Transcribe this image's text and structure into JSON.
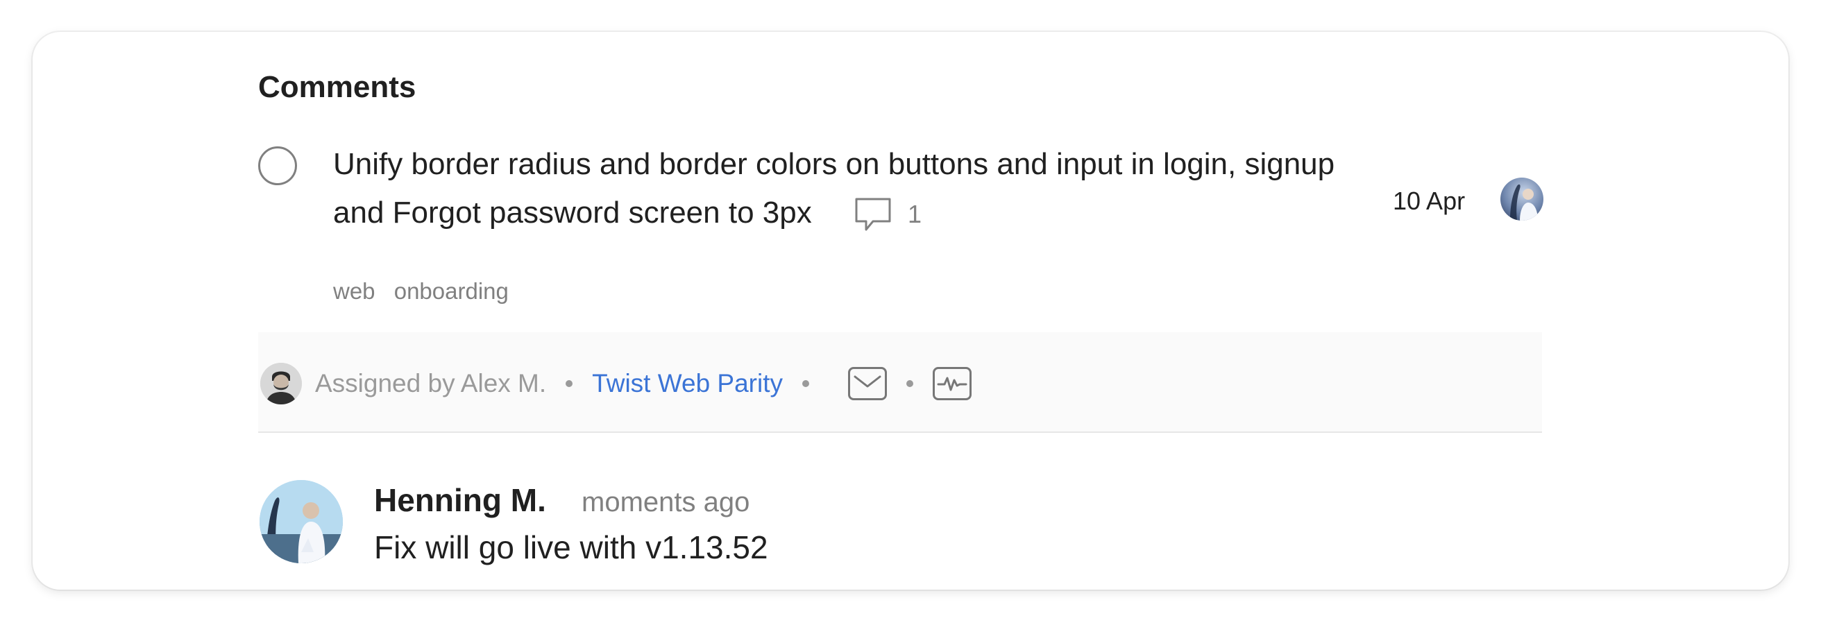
{
  "comments_panel": {
    "title": "Comments"
  },
  "task": {
    "content": "Unify border radius and border colors on buttons and input in login, signup and Forgot password screen to 3px",
    "comment_count": "1",
    "labels": [
      "web",
      "onboarding"
    ],
    "due_date": "10 Apr",
    "assignee_avatar_icon": "user-avatar"
  },
  "meta": {
    "assigned_by": "Assigned by Alex M.",
    "project": "Twist Web Parity",
    "mail_icon": "mail-icon",
    "activity_icon": "activity-icon",
    "project_color": "#3b74d6"
  },
  "comment": {
    "author": "Henning M.",
    "time": "moments ago",
    "text": "Fix will go live with v1.13.52"
  }
}
